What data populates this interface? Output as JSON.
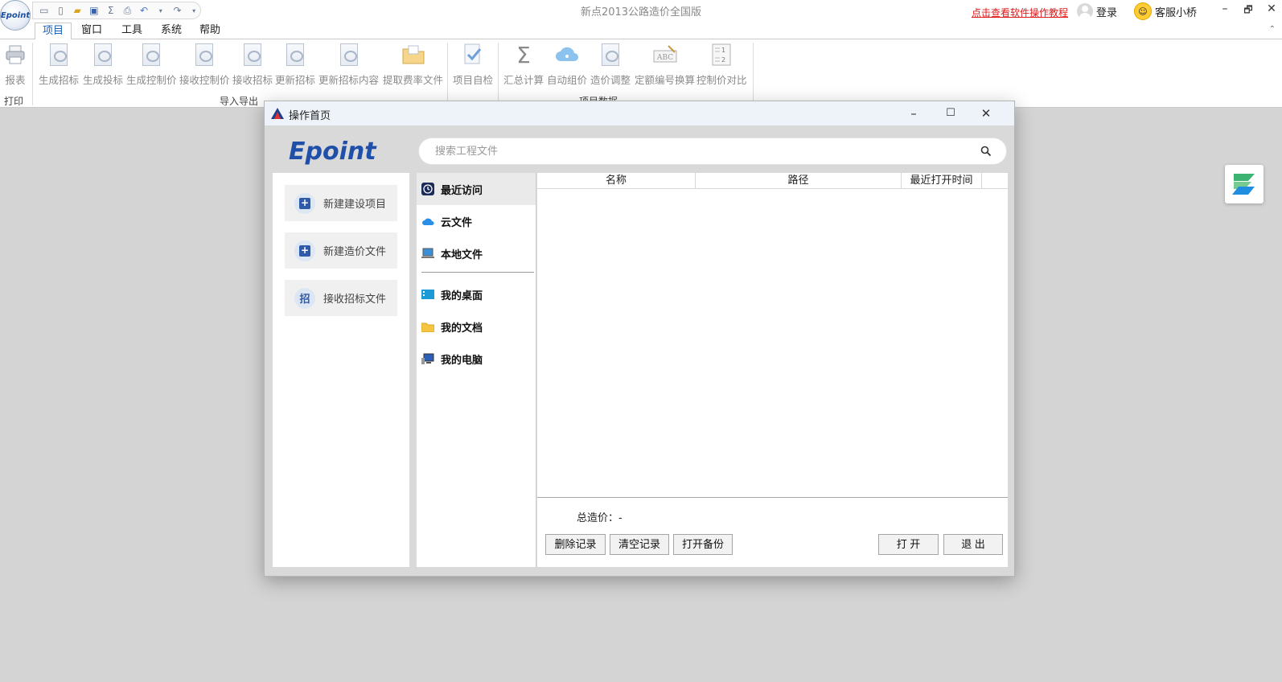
{
  "app": {
    "logo_text": "Epoint",
    "title": "新点2013公路造价全国版",
    "help_link": "点击查看软件操作教程",
    "login_label": "登录",
    "service_label": "客服小桥"
  },
  "quick_access": {
    "icons": [
      "new-doc-icon",
      "blank-doc-icon",
      "open-folder-icon",
      "save-icon",
      "sigma-icon",
      "print-icon",
      "undo-icon",
      "redo-icon",
      "dropdown-icon"
    ]
  },
  "window_controls": {
    "minimize": "–",
    "restore": "🗗",
    "close": "✕"
  },
  "menu": {
    "tabs": [
      "项目",
      "窗口",
      "工具",
      "系统",
      "帮助"
    ],
    "active_tab": "项目"
  },
  "ribbon": {
    "groups": {
      "print": "打印",
      "import_export": "导入导出",
      "project_data": "项目数据"
    },
    "buttons": {
      "report": "报表",
      "gen_tender": "生成招标",
      "gen_bid": "生成投标",
      "gen_control": "生成控制价",
      "recv_control": "接收控制价",
      "recv_tender": "接收招标",
      "update_tender": "更新招标",
      "update_tender_content": "更新招标内容",
      "extract_rate": "提取费率文件",
      "self_check": "项目自检",
      "summary_calc": "汇总计算",
      "auto_price": "自动组价",
      "price_adjust": "造价调整",
      "quota_convert": "定额编号换算",
      "control_compare": "控制价对比"
    }
  },
  "dialog": {
    "title": "操作首页",
    "logo_text": "Epoint",
    "search": {
      "placeholder": "搜索工程文件",
      "value": ""
    },
    "actions": [
      "新建建设项目",
      "新建造价文件",
      "接收招标文件"
    ],
    "action_zh_icon": "招",
    "nav": {
      "recent": "最近访问",
      "cloud": "云文件",
      "local": "本地文件",
      "desktop": "我的桌面",
      "documents": "我的文档",
      "computer": "我的电脑"
    },
    "table": {
      "columns": [
        "名称",
        "路径",
        "最近打开时间"
      ],
      "rows": []
    },
    "total_label": "总造价：-",
    "buttons": {
      "delete_record": "删除记录",
      "clear_records": "清空记录",
      "open_backup": "打开备份",
      "open": "打 开",
      "exit": "退 出"
    }
  },
  "colors": {
    "accent_blue": "#1a5fb4",
    "link_red": "#e01818",
    "workspace_gray": "#d4d4d4",
    "epoint_blue": "#1f4fa8"
  }
}
